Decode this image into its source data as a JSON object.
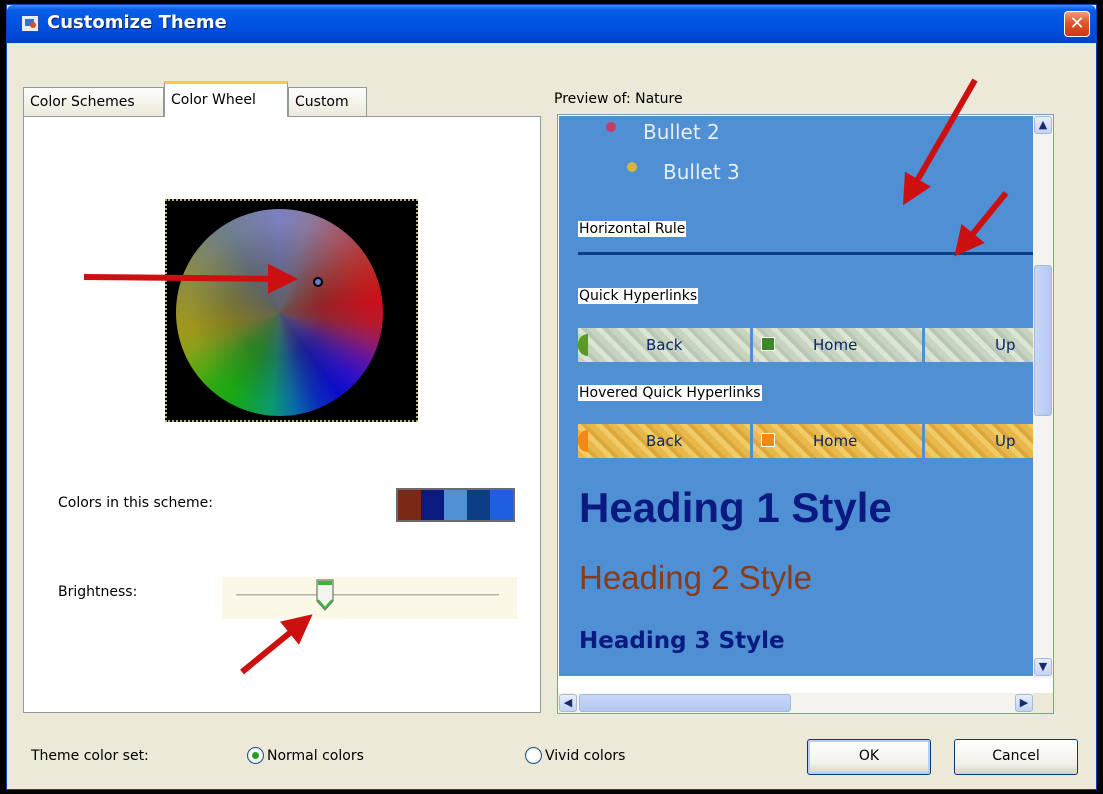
{
  "window": {
    "title": "Customize Theme",
    "close_label": "✕"
  },
  "tabs": [
    {
      "label": "Color Schemes",
      "active": false
    },
    {
      "label": "Color Wheel",
      "active": true
    },
    {
      "label": "Custom",
      "active": false
    }
  ],
  "scheme": {
    "label": "Colors in this scheme:",
    "colors": [
      "#7a2a14",
      "#0a1a80",
      "#4f8fd3",
      "#0c3e86",
      "#1e5fe0"
    ]
  },
  "brightness": {
    "label": "Brightness:",
    "level": 0.34
  },
  "preview": {
    "label": "Preview of: Nature",
    "bullet2": "Bullet 2",
    "bullet3": "Bullet 3",
    "hr_label": "Horizontal Rule",
    "quick_label": "Quick Hyperlinks",
    "hovered_label": "Hovered Quick Hyperlinks",
    "links": [
      "Back",
      "Home",
      "Up"
    ],
    "h1": "Heading 1 Style",
    "h2": "Heading 2 Style",
    "h3": "Heading 3 Style",
    "background_color": "#4f8fd3"
  },
  "footer": {
    "set_label": "Theme color set:",
    "normal": "Normal colors",
    "vivid": "Vivid colors",
    "selected": "normal",
    "ok": "OK",
    "cancel": "Cancel"
  },
  "annotation_color": "#cc1010"
}
